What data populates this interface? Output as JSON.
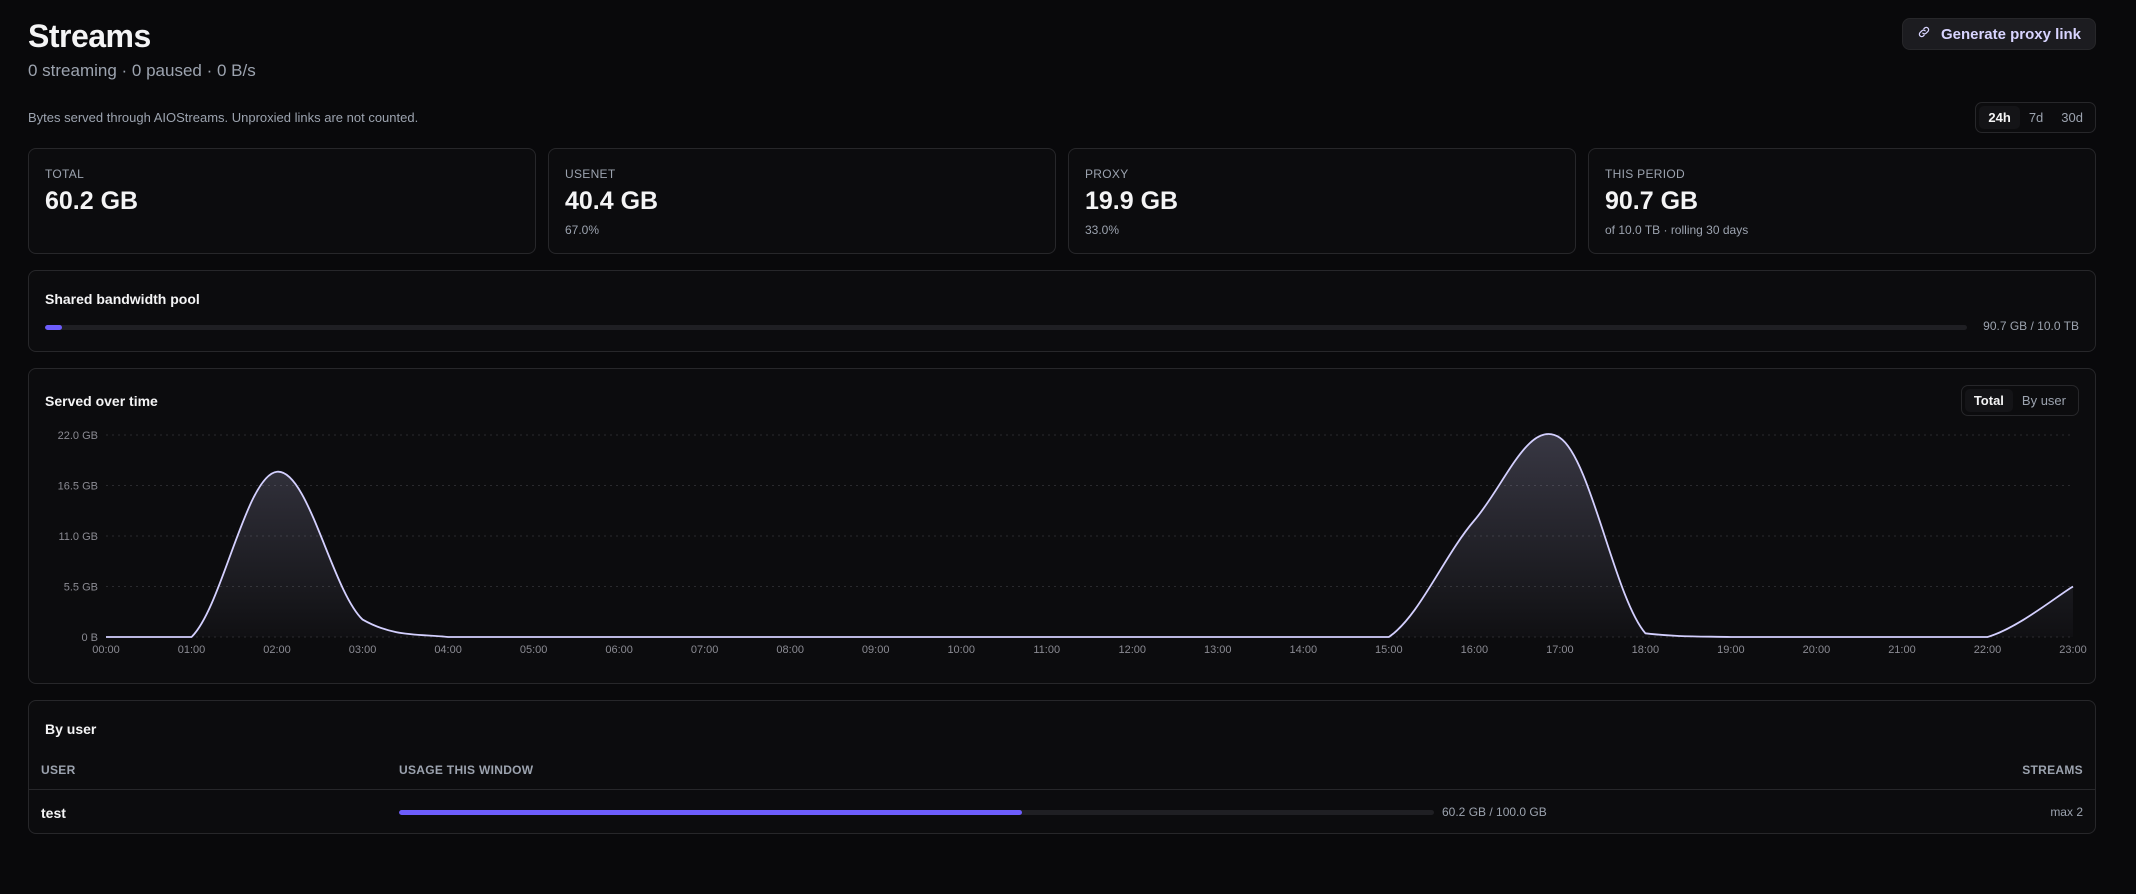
{
  "page": {
    "title": "Streams",
    "subtitle": "0 streaming · 0 paused · 0 B/s",
    "note": "Bytes served through AIOStreams. Unproxied links are not counted."
  },
  "proxy_button": {
    "label": "Generate proxy link",
    "icon": "link-icon"
  },
  "period_options": [
    "24h",
    "7d",
    "30d"
  ],
  "period_selected": "24h",
  "stats": [
    {
      "label": "TOTAL",
      "value": "60.2 GB",
      "sub": ""
    },
    {
      "label": "USENET",
      "value": "40.4 GB",
      "sub": "67.0%"
    },
    {
      "label": "PROXY",
      "value": "19.9 GB",
      "sub": "33.0%"
    },
    {
      "label": "THIS PERIOD",
      "value": "90.7 GB",
      "sub": "of 10.0 TB · rolling 30 days"
    }
  ],
  "pool": {
    "title": "Shared bandwidth pool",
    "usage_text": "90.7 GB / 10.0 TB",
    "fraction": 0.009
  },
  "chart_section": {
    "title": "Served over time",
    "toggle": [
      "Total",
      "By user"
    ],
    "toggle_selected": "Total"
  },
  "colors": {
    "accent": "#6d5dfc",
    "line": "#d4d0ff",
    "background": "#09090b",
    "card": "#0c0c0e"
  },
  "chart_data": {
    "type": "area",
    "title": "",
    "xlabel": "",
    "ylabel": "",
    "ylim": [
      0,
      22
    ],
    "unit": "GB",
    "y_ticks": [
      "0 B",
      "5.5 GB",
      "11.0 GB",
      "16.5 GB",
      "22.0 GB"
    ],
    "x": [
      "00:00",
      "01:00",
      "02:00",
      "03:00",
      "04:00",
      "05:00",
      "06:00",
      "07:00",
      "08:00",
      "09:00",
      "10:00",
      "11:00",
      "12:00",
      "13:00",
      "14:00",
      "15:00",
      "16:00",
      "17:00",
      "18:00",
      "19:00",
      "20:00",
      "21:00",
      "22:00",
      "23:00"
    ],
    "values": [
      0,
      0,
      18,
      1.9,
      0,
      0,
      0,
      0,
      0,
      0,
      0,
      0,
      0,
      0,
      0,
      0,
      12.7,
      21.7,
      0.4,
      0,
      0,
      0,
      0,
      5.5
    ],
    "grid": true,
    "legend": "none"
  },
  "by_user": {
    "title": "By user",
    "columns": [
      "USER",
      "USAGE THIS WINDOW",
      "STREAMS"
    ],
    "rows": [
      {
        "user": "test",
        "usage_text": "60.2 GB / 100.0 GB",
        "fraction": 0.602,
        "streams": "max 2"
      }
    ]
  }
}
